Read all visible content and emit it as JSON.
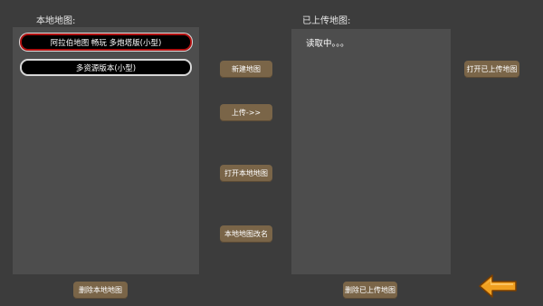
{
  "local": {
    "title": "本地地图:",
    "maps": [
      {
        "label": "阿拉伯地图 畅玩 多炮塔版(小型)",
        "selected": true
      },
      {
        "label": "多资源版本(小型)",
        "selected": false
      }
    ]
  },
  "uploaded": {
    "title": "已上传地图:",
    "loading_text": "读取中。。。"
  },
  "buttons": {
    "new_map": "新建地图",
    "upload": "上传->>",
    "open_local": "打开本地地图",
    "rename_local": "本地地图改名",
    "delete_local": "删除本地地图",
    "open_uploaded": "打开已上传地图",
    "delete_uploaded": "删除已上传地图"
  },
  "icons": {
    "back": "back-arrow-icon"
  },
  "colors": {
    "background": "#3c3c3c",
    "panel": "#4d4d4d",
    "button": "#7a6548",
    "selected_border": "#b01010",
    "back_arrow": "#f0a020"
  }
}
